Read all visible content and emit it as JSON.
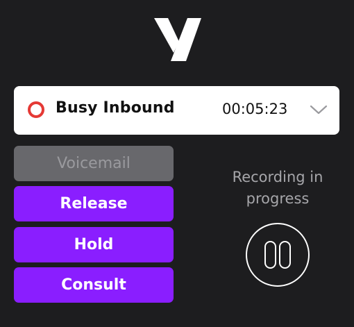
{
  "status": {
    "label": "Busy Inbound",
    "timer": "00:05:23",
    "indicator_color": "#e53935",
    "indicator_icon": "record-ring-icon",
    "expand_icon": "chevron-down-icon"
  },
  "actions": {
    "voicemail_label": "Voicemail",
    "release_label": "Release",
    "hold_label": "Hold",
    "consult_label": "Consult",
    "accent_color": "#8a1eff",
    "disabled_color": "#68686c"
  },
  "recording": {
    "text_line1": "Recording in",
    "text_line2": "progress",
    "pause_icon": "pause-icon"
  },
  "brand": {
    "logo_icon": "brand-v-logo-icon"
  }
}
